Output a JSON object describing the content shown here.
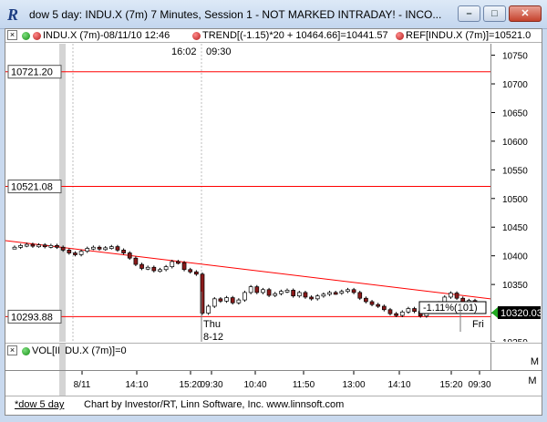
{
  "window": {
    "title": "dow 5 day: INDU.X (7m) 7 Minutes, Session 1 - NOT MARKED INTRADAY! - INCO...",
    "icon": "R",
    "minimize": "–",
    "maximize": "□",
    "close": "✕"
  },
  "header": {
    "close_box": "×",
    "symbol": "INDU.X (7m)-08/11/10 12:46",
    "trend": "TREND[(-1.15)*20 + 10464.66]=10441.57",
    "ref": "REF[INDU.X (7m)]=10521.0",
    "menu": "M"
  },
  "session_labels": {
    "close": "16:02",
    "open": "09:30"
  },
  "levels": [
    {
      "label": "10721.20",
      "value": 10721.2
    },
    {
      "label": "10521.08",
      "value": 10521.08
    },
    {
      "label": "10293.88",
      "value": 10293.88
    }
  ],
  "trend_label": "-1.11%(101)",
  "last_price": "10320.03",
  "day_markers": [
    {
      "day": "Thu",
      "date": "8-12"
    },
    {
      "day": "Fri",
      "date": ""
    }
  ],
  "volume": {
    "close_box": "×",
    "label": "VOL[INDU.X (7m)]=0",
    "menu": "M"
  },
  "x_axis_labels": [
    "8/11",
    "14:10",
    "15:20",
    "09:30",
    "10:40",
    "11:50",
    "13:00",
    "14:10",
    "15:20",
    "09:30"
  ],
  "status": {
    "tab": "*dow 5 day",
    "credit": "Chart by Investor/RT, Linn Software, Inc. www.linnsoft.com"
  },
  "colors": {
    "level_line": "#ff0000",
    "up_candle": "#ffffff",
    "down_candle": "#8b1a1a",
    "last_price_bg": "#000000",
    "arrow": "#22aa22"
  },
  "chart_data": {
    "type": "line",
    "title": "",
    "xlabel": "",
    "ylabel": "",
    "ylim": [
      10250,
      10770
    ],
    "y_ticks": [
      10750,
      10700,
      10650,
      10600,
      10550,
      10500,
      10450,
      10400,
      10350,
      10300,
      10250
    ],
    "series": [
      {
        "values": [
          10415,
          10418,
          10420,
          10417,
          10419,
          10416,
          10418,
          10415,
          10410,
          10405,
          10402,
          10408,
          10413,
          10415,
          10412,
          10414,
          10416,
          10410,
          10405,
          10396,
          10385,
          10378,
          10380,
          10374,
          10376,
          10381,
          10390,
          10388,
          10376,
          10372,
          10368,
          10300,
          10312,
          10325,
          10321,
          10327,
          10318,
          10323,
          10336,
          10346,
          10336,
          10341,
          10331,
          10334,
          10338,
          10340,
          10330,
          10336,
          10328,
          10325,
          10330,
          10333,
          10336,
          10335,
          10338,
          10341,
          10336,
          10326,
          10320,
          10315,
          10312,
          10306,
          10299,
          10296,
          10302,
          10308,
          10303,
          10295,
          10302,
          10312,
          10318,
          10328,
          10335,
          10326,
          10319,
          10322,
          10320
        ]
      }
    ]
  }
}
